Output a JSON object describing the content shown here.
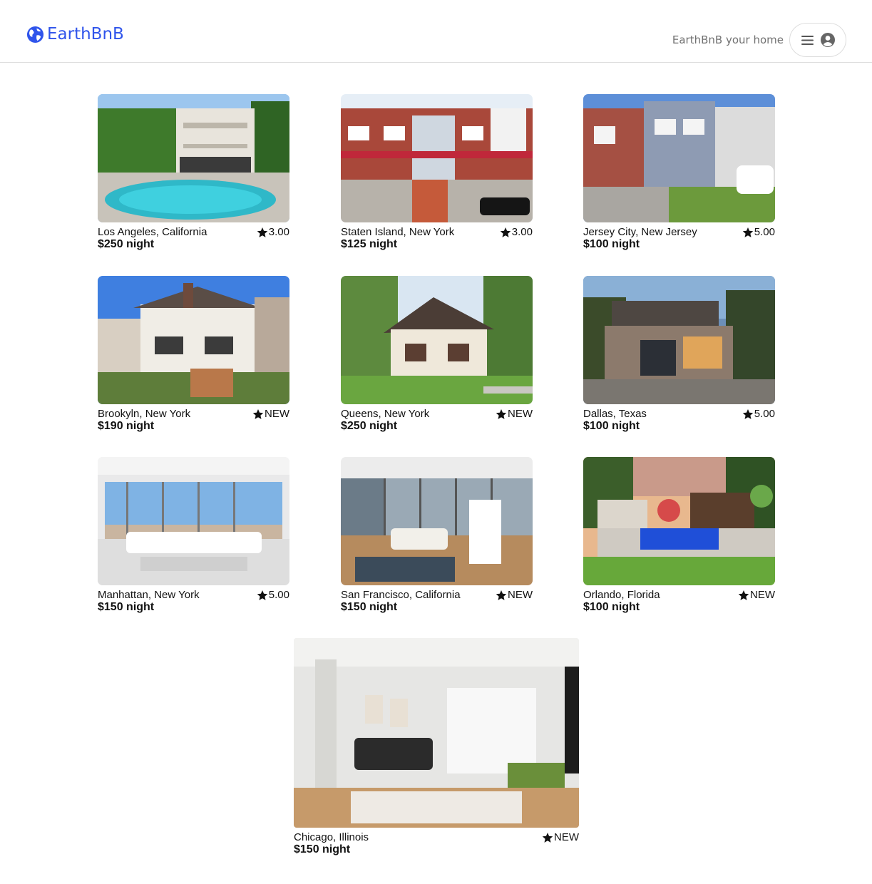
{
  "header": {
    "brand": "EarthBnB",
    "host_link": "EarthBnB your home",
    "logo_icon": "globe-icon",
    "menu_icon": "hamburger-icon",
    "user_icon": "user-circle-icon",
    "brand_color": "#2f54eb"
  },
  "listings": [
    {
      "location": "Los Angeles, California",
      "price": "$250 night",
      "rating": "3.00",
      "scene": "pool-villa"
    },
    {
      "location": "Staten Island, New York",
      "price": "$125 night",
      "rating": "3.00",
      "scene": "brick-rowhouses"
    },
    {
      "location": "Jersey City, New Jersey",
      "price": "$100 night",
      "rating": "5.00",
      "scene": "suburban-houses"
    },
    {
      "location": "Brookyln, New York",
      "price": "$190 night",
      "rating": "NEW",
      "scene": "white-colonial"
    },
    {
      "location": "Queens, New York",
      "price": "$250 night",
      "rating": "NEW",
      "scene": "tudor-house"
    },
    {
      "location": "Dallas, Texas",
      "price": "$100 night",
      "rating": "5.00",
      "scene": "modern-house-dusk"
    },
    {
      "location": "Manhattan, New York",
      "price": "$150 night",
      "rating": "5.00",
      "scene": "penthouse-living"
    },
    {
      "location": "San Francisco, California",
      "price": "$150 night",
      "rating": "NEW",
      "scene": "highrise-apartment"
    },
    {
      "location": "Orlando, Florida",
      "price": "$100 night",
      "rating": "NEW",
      "scene": "backyard-pool"
    },
    {
      "location": "Chicago, Illinois",
      "price": "$150 night",
      "rating": "NEW",
      "scene": "bright-living-room"
    }
  ]
}
